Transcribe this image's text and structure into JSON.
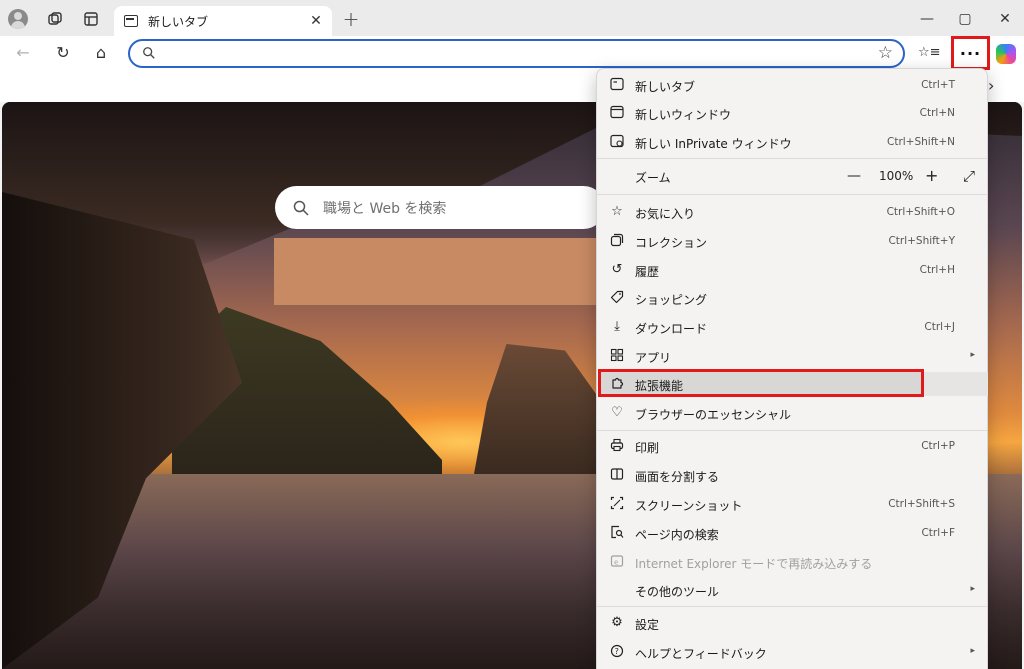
{
  "tabbar": {
    "tab_title": "新しいタブ",
    "close_glyph": "✕",
    "new_tab_glyph": "+",
    "window": {
      "minimize": "—",
      "maximize": "▢",
      "close": "✕"
    }
  },
  "toolbar": {
    "back_glyph": "←",
    "refresh_glyph": "↻",
    "home_glyph": "⌂",
    "address_value": "",
    "star_glyph": "☆",
    "favorites_glyph": "☆≡",
    "more_glyph": "···"
  },
  "page": {
    "search_placeholder": "職場と Web を検索",
    "chevron": "›"
  },
  "menu": {
    "items": [
      {
        "label": "新しいタブ",
        "shortcut": "Ctrl+T",
        "icon": "new-tab-icon"
      },
      {
        "label": "新しいウィンドウ",
        "shortcut": "Ctrl+N",
        "icon": "window-icon"
      },
      {
        "label": "新しい InPrivate ウィンドウ",
        "shortcut": "Ctrl+Shift+N",
        "icon": "inprivate-icon"
      },
      {
        "label": "ズーム",
        "zoom_minus": "—",
        "zoom_value": "100%",
        "zoom_plus": "+",
        "fullscreen": "⤢"
      },
      {
        "label": "お気に入り",
        "shortcut": "Ctrl+Shift+O",
        "icon": "favorites-icon"
      },
      {
        "label": "コレクション",
        "shortcut": "Ctrl+Shift+Y",
        "icon": "collections-icon"
      },
      {
        "label": "履歴",
        "shortcut": "Ctrl+H",
        "icon": "history-icon"
      },
      {
        "label": "ショッピング",
        "shortcut": "",
        "icon": "shopping-tag-icon"
      },
      {
        "label": "ダウンロード",
        "shortcut": "Ctrl+J",
        "icon": "download-icon"
      },
      {
        "label": "アプリ",
        "shortcut": "",
        "icon": "apps-icon",
        "submenu": "▸"
      },
      {
        "label": "拡張機能",
        "shortcut": "",
        "icon": "extensions-icon"
      },
      {
        "label": "ブラウザーのエッセンシャル",
        "shortcut": "",
        "icon": "heart-pulse-icon"
      },
      {
        "label": "印刷",
        "shortcut": "Ctrl+P",
        "icon": "print-icon"
      },
      {
        "label": "画面を分割する",
        "shortcut": "",
        "icon": "split-screen-icon"
      },
      {
        "label": "スクリーンショット",
        "shortcut": "Ctrl+Shift+S",
        "icon": "screenshot-icon"
      },
      {
        "label": "ページ内の検索",
        "shortcut": "Ctrl+F",
        "icon": "find-in-page-icon"
      },
      {
        "label": "Internet Explorer モードで再読み込みする",
        "shortcut": "",
        "icon": "ie-mode-icon"
      },
      {
        "label": "その他のツール",
        "shortcut": "",
        "icon": "",
        "submenu": "▸"
      },
      {
        "label": "設定",
        "shortcut": "",
        "icon": "settings-gear-icon"
      },
      {
        "label": "ヘルプとフィードバック",
        "shortcut": "",
        "icon": "help-icon",
        "submenu": "▸"
      }
    ]
  },
  "colors": {
    "highlight_red": "#e01a1a",
    "address_border": "#2a63c9",
    "menu_bg": "#f4f3f2"
  }
}
